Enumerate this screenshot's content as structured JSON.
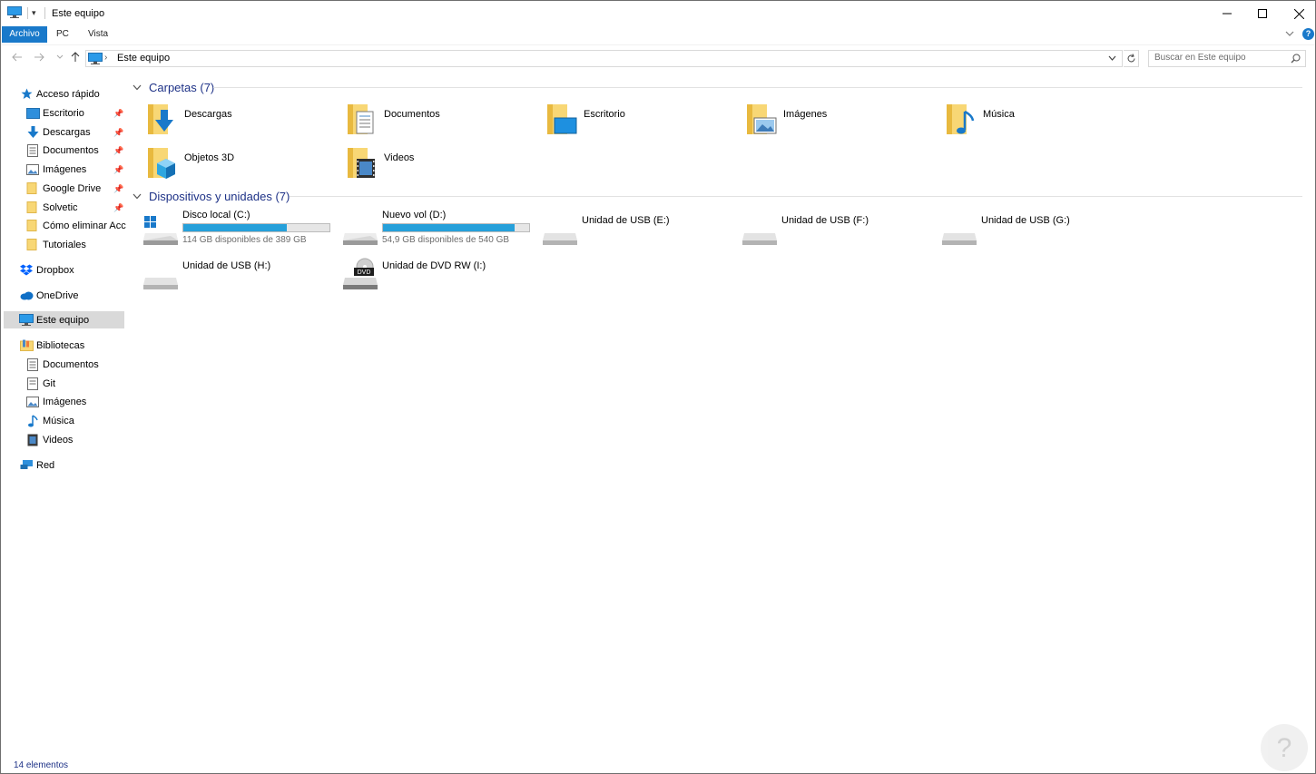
{
  "window": {
    "title": "Este equipo",
    "quick_access_glyph": "▾"
  },
  "ribbon": {
    "tabs": [
      "Archivo",
      "PC",
      "Vista"
    ],
    "help_label": "?"
  },
  "navigation": {
    "address_separator": "›",
    "address_path": "Este equipo",
    "search_placeholder": "Buscar en Este equipo"
  },
  "sidebar": {
    "quick_access": {
      "label": "Acceso rápido",
      "icon": "star-icon"
    },
    "pinned": [
      {
        "label": "Escritorio",
        "icon": "desktop-icon",
        "pinned": true
      },
      {
        "label": "Descargas",
        "icon": "download-icon",
        "pinned": true
      },
      {
        "label": "Documentos",
        "icon": "document-icon",
        "pinned": true
      },
      {
        "label": "Imágenes",
        "icon": "image-icon",
        "pinned": true
      },
      {
        "label": "Google Drive",
        "icon": "folder-icon",
        "pinned": true
      },
      {
        "label": "Solvetic",
        "icon": "folder-icon",
        "pinned": true
      },
      {
        "label": "Cómo eliminar Acc",
        "icon": "folder-icon",
        "pinned": false
      },
      {
        "label": "Tutoriales",
        "icon": "folder-icon",
        "pinned": false
      }
    ],
    "dropbox": {
      "label": "Dropbox",
      "icon": "dropbox-icon"
    },
    "onedrive": {
      "label": "OneDrive",
      "icon": "cloud-icon"
    },
    "this_pc": {
      "label": "Este equipo",
      "icon": "computer-icon"
    },
    "libraries": {
      "label": "Bibliotecas",
      "icon": "library-icon"
    },
    "library_items": [
      {
        "label": "Documentos",
        "icon": "document-icon"
      },
      {
        "label": "Git",
        "icon": "document-icon"
      },
      {
        "label": "Imágenes",
        "icon": "image-icon"
      },
      {
        "label": "Música",
        "icon": "music-icon"
      },
      {
        "label": "Videos",
        "icon": "video-icon"
      }
    ],
    "network": {
      "label": "Red",
      "icon": "network-icon"
    }
  },
  "content": {
    "folders_header": "Carpetas (7)",
    "folders": [
      {
        "name": "Descargas",
        "icon": "download-folder-icon"
      },
      {
        "name": "Documentos",
        "icon": "documents-folder-icon"
      },
      {
        "name": "Escritorio",
        "icon": "desktop-folder-icon"
      },
      {
        "name": "Imágenes",
        "icon": "pictures-folder-icon"
      },
      {
        "name": "Música",
        "icon": "music-folder-icon"
      },
      {
        "name": "Objetos 3D",
        "icon": "3d-objects-folder-icon"
      },
      {
        "name": "Videos",
        "icon": "videos-folder-icon"
      }
    ],
    "devices_header": "Dispositivos y unidades (7)",
    "drives": [
      {
        "name": "Disco local (C:)",
        "free": "114 GB disponibles de 389 GB",
        "used_fraction": 0.707,
        "icon": "windows-drive-icon"
      },
      {
        "name": "Nuevo vol (D:)",
        "free": "54,9 GB disponibles de 540 GB",
        "used_fraction": 0.898,
        "icon": "hard-drive-icon"
      },
      {
        "name": "Unidad de USB (E:)",
        "icon": "usb-drive-icon"
      },
      {
        "name": "Unidad de USB (F:)",
        "icon": "usb-drive-icon"
      },
      {
        "name": "Unidad de USB (G:)",
        "icon": "usb-drive-icon"
      },
      {
        "name": "Unidad de USB (H:)",
        "icon": "usb-drive-icon"
      },
      {
        "name": "Unidad de DVD RW (I:)",
        "icon": "dvd-drive-icon",
        "badge": "DVD"
      }
    ]
  },
  "status": {
    "item_count": "14 elementos"
  },
  "colors": {
    "accent": "#1979ca",
    "selection": "#d9d9d9",
    "header_text": "#1e3287",
    "usage_bar": "#26a0da"
  }
}
